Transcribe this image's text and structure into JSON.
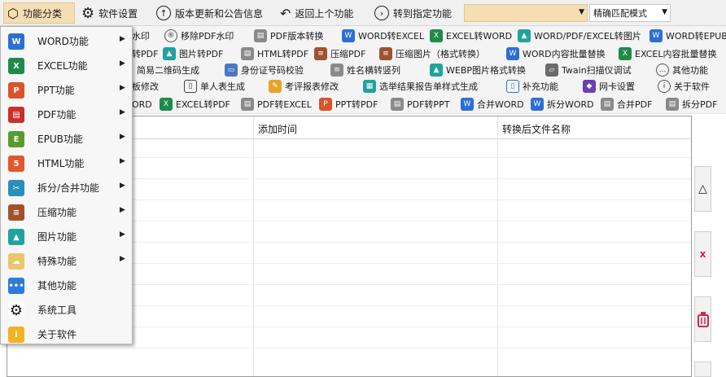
{
  "top": {
    "category": "功能分类",
    "settings": "软件设置",
    "update": "版本更新和公告信息",
    "back": "返回上个功能",
    "goto": "转到指定功能",
    "goto_value": "",
    "match": "精确匹配模式"
  },
  "row1": [
    "水印",
    "移除PDF水印",
    "PDF版本转换",
    "WORD转EXCEL",
    "EXCEL转WORD",
    "WORD/PDF/EXCEL转图片",
    "WORD转EPUB"
  ],
  "row2": [
    "转PDF",
    "图片转PDF",
    "HTML转PDF",
    "压缩PDF",
    "压缩图片（格式转换）",
    "WORD内容批量替换",
    "EXCEL内容批量替换"
  ],
  "row3": [
    "简易二维码生成",
    "身份证号码校验",
    "姓名横转竖列",
    "WEBP图片格式转换",
    "Twain扫描仪调试",
    "其他功能"
  ],
  "row4": [
    "板修改",
    "单人表生成",
    "考评报表修改",
    "选举结果报告单样式生成",
    "补充功能",
    "网卡设置",
    "关于软件"
  ],
  "row5": [
    "ORD",
    "EXCEL转PDF",
    "PDF转EXCEL",
    "PPT转PDF",
    "PDF转PPT",
    "合并WORD",
    "拆分WORD",
    "合并PDF",
    "拆分PDF"
  ],
  "grid": {
    "col2": "添加时间",
    "col3": "转换后文件名称"
  },
  "side": {
    "up": "△",
    "remove": "x"
  },
  "menu": [
    {
      "label": "WORD功能",
      "icon": "word-icon",
      "color": "#2b6fd6",
      "glyph": "W",
      "arrow": "▶"
    },
    {
      "label": "EXCEL功能",
      "icon": "excel-icon",
      "color": "#1f8a4c",
      "glyph": "X",
      "arrow": "▶"
    },
    {
      "label": "PPT功能",
      "icon": "ppt-icon",
      "color": "#d9542b",
      "glyph": "P",
      "arrow": "▶"
    },
    {
      "label": "PDF功能",
      "icon": "pdf-icon",
      "color": "#c8312b",
      "glyph": "▤",
      "arrow": "▶"
    },
    {
      "label": "EPUB功能",
      "icon": "epub-icon",
      "color": "#5a9b2e",
      "glyph": "E",
      "arrow": "▶"
    },
    {
      "label": "HTML功能",
      "icon": "html-icon",
      "color": "#e4572e",
      "glyph": "5",
      "arrow": "▶"
    },
    {
      "label": "拆分/合并功能",
      "icon": "scissors-icon",
      "color": "#2a8fb8",
      "glyph": "✂",
      "arrow": "▶"
    },
    {
      "label": "压缩功能",
      "icon": "compress-icon",
      "color": "#a0522d",
      "glyph": "≡",
      "arrow": "▶"
    },
    {
      "label": "图片功能",
      "icon": "image-icon",
      "color": "#20a39e",
      "glyph": "▲",
      "arrow": "▶"
    },
    {
      "label": "特殊功能",
      "icon": "cloud-icon",
      "color": "#e8c66a",
      "glyph": "☁",
      "arrow": "▶"
    },
    {
      "label": "其他功能",
      "icon": "more-icon",
      "color": "#2f7bd8",
      "glyph": "•••",
      "arrow": ""
    },
    {
      "label": "系统工具",
      "icon": "gear-icon",
      "color": "#ffffff",
      "glyph": "⚙",
      "arrow": ""
    },
    {
      "label": "关于软件",
      "icon": "info-icon",
      "color": "#f0b323",
      "glyph": "i",
      "arrow": ""
    }
  ],
  "colors": {
    "menu_highlight": "#f5deb3",
    "trash": "#d7263d"
  }
}
